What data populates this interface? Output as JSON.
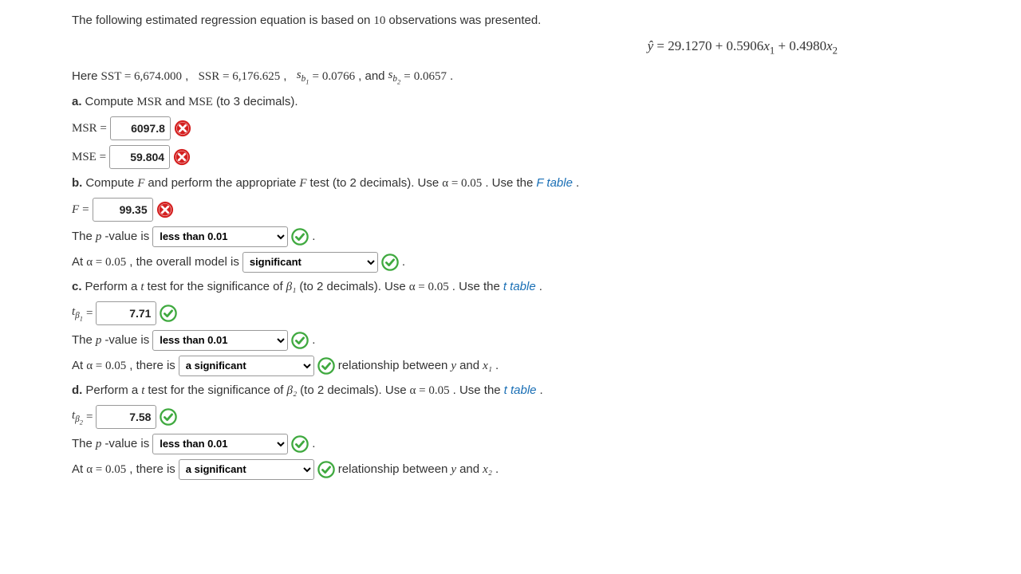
{
  "intro_a": "The following estimated regression equation is based on ",
  "n_obs": "10",
  "intro_b": " observations was presented.",
  "equation": "ŷ = 29.1270 + 0.5906x₁ + 0.4980x₂",
  "given": {
    "pre": "Here ",
    "sst_label": "SST = 6,674.000",
    "ssr_label": "SSR = 6,176.625",
    "sb1_val": "0.0766",
    "sb2_val": "0.0657"
  },
  "a": {
    "label": "a.",
    "text": " Compute ",
    "msr": "MSR",
    "mse": "MSE",
    "tail": " (to 3 decimals).",
    "msr_val": "6097.8",
    "mse_val": "59.804"
  },
  "b": {
    "label": "b.",
    "t1": " Compute ",
    "t2": " and perform the appropriate ",
    "t3": " test (to 2 decimals). Use ",
    "alpha": "α = 0.05",
    "t4": ". Use the ",
    "link": "F table",
    "f_val": "99.35",
    "pval_pre": "The ",
    "pval_mid": "-value is",
    "pval_sel": "less than 0.01",
    "overall_pre": "At ",
    "overall_mid": ", the overall model is",
    "overall_sel": "significant"
  },
  "c": {
    "label": "c.",
    "t1": " Perform a ",
    "t2": " test for the significance of ",
    "beta": "β₁",
    "t3": " (to 2 decimals). Use ",
    "alpha": "α = 0.05",
    "t4": ". Use the ",
    "link": "t table",
    "t_val": "7.71",
    "pval_sel": "less than 0.01",
    "rel_pre": "At ",
    "rel_mid": ", there is",
    "rel_sel": "a significant",
    "rel_tail_a": " relationship between ",
    "rel_tail_b": " and ",
    "yvar": "y",
    "xvar": "x₁"
  },
  "d": {
    "label": "d.",
    "t1": " Perform a ",
    "t2": " test for the significance of ",
    "beta": "β₂",
    "t3": " (to 2 decimals). Use ",
    "alpha": "α = 0.05",
    "t4": ". Use the ",
    "link": "t table",
    "t_val": "7.58",
    "pval_sel": "less than 0.01",
    "rel_sel": "a significant",
    "xvar": "x₂"
  },
  "labels": {
    "msr_eq": "MSR =",
    "mse_eq": "MSE =",
    "f_eq": "F =",
    "and": " and "
  }
}
